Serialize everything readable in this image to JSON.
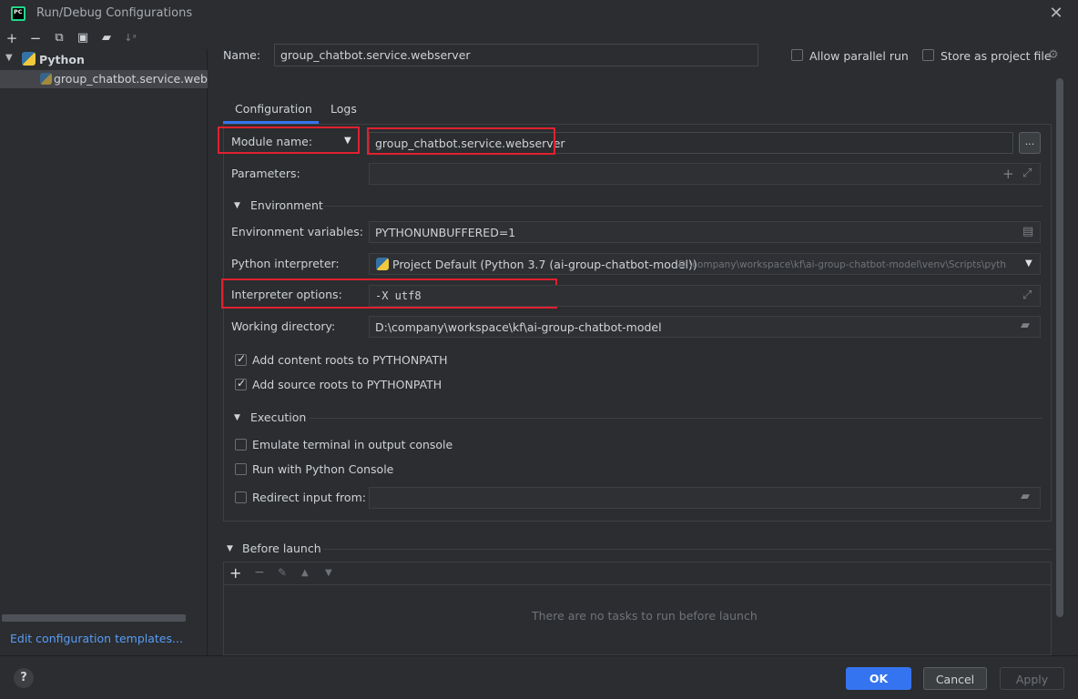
{
  "window": {
    "title": "Run/Debug Configurations",
    "app_icon_text": "PC"
  },
  "toolbar": {
    "icons": [
      "add-icon",
      "remove-icon",
      "copy-icon",
      "save-icon",
      "folder-add-icon",
      "sort-icon"
    ]
  },
  "tree": {
    "root_label": "Python",
    "child_label": "group_chatbot.service.webserver"
  },
  "left_footer": {
    "templates_link": "Edit configuration templates..."
  },
  "header": {
    "name_label": "Name:",
    "name_value": "group_chatbot.service.webserver",
    "allow_parallel_label": "Allow parallel run",
    "store_project_label": "Store as project file"
  },
  "tabs": [
    {
      "label": "Configuration",
      "active": true
    },
    {
      "label": "Logs",
      "active": false
    }
  ],
  "form": {
    "module_label": "Module name:",
    "module_value": "group_chatbot.service.webserver",
    "module_browse": "...",
    "parameters_label": "Parameters:",
    "environment_section": "Environment",
    "env_vars_label": "Environment variables:",
    "env_vars_value": "PYTHONUNBUFFERED=1",
    "interpreter_label": "Python interpreter:",
    "interpreter_value": "Project Default (Python 3.7 (ai-group-chatbot-model))",
    "interpreter_path": "D:\\company\\workspace\\kf\\ai-group-chatbot-model\\venv\\Scripts\\pyth",
    "interp_options_label": "Interpreter options:",
    "interp_options_value": "-X utf8",
    "workdir_label": "Working directory:",
    "workdir_value": "D:\\company\\workspace\\kf\\ai-group-chatbot-model",
    "content_roots_label": "Add content roots to PYTHONPATH",
    "content_roots_checked": true,
    "source_roots_label": "Add source roots to PYTHONPATH",
    "source_roots_checked": true,
    "execution_section": "Execution",
    "emulate_terminal_label": "Emulate terminal in output console",
    "python_console_label": "Run with Python Console",
    "redirect_input_label": "Redirect input from:"
  },
  "before_launch": {
    "section": "Before launch",
    "empty_text": "There are no tasks to run before launch"
  },
  "buttons": {
    "ok": "OK",
    "cancel": "Cancel",
    "apply": "Apply"
  },
  "colors": {
    "accent": "#3574f0",
    "highlight_box": "#e0212f",
    "link": "#589df6"
  }
}
